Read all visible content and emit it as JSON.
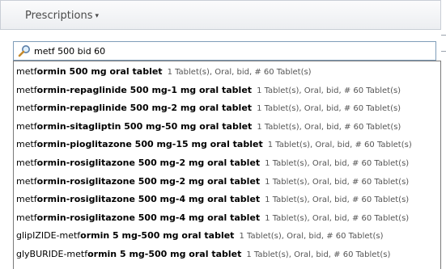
{
  "header": {
    "title": "Prescriptions",
    "dropdown_caret": "▾"
  },
  "search": {
    "value": "metf 500 bid 60",
    "icon": "search-magnifier-icon"
  },
  "results": [
    {
      "prefix": "metf",
      "name_rest": "ormin",
      "dose": " 500 mg oral tablet",
      "sig": "1 Tablet(s), Oral, bid, # 60 Tablet(s)"
    },
    {
      "prefix": "metf",
      "name_rest": "ormin-repaglinide",
      "dose": " 500 mg-1 mg oral tablet",
      "sig": "1 Tablet(s), Oral, bid, # 60 Tablet(s)"
    },
    {
      "prefix": "metf",
      "name_rest": "ormin-repaglinide",
      "dose": " 500 mg-2 mg oral tablet",
      "sig": "1 Tablet(s), Oral, bid, # 60 Tablet(s)"
    },
    {
      "prefix": "metf",
      "name_rest": "ormin-sitagliptin",
      "dose": " 500 mg-50 mg oral tablet",
      "sig": "1 Tablet(s), Oral, bid, # 60 Tablet(s)"
    },
    {
      "prefix": "metf",
      "name_rest": "ormin-pioglitazone",
      "dose": " 500 mg-15 mg oral tablet",
      "sig": "1 Tablet(s), Oral, bid, # 60 Tablet(s)"
    },
    {
      "prefix": "metf",
      "name_rest": "ormin-rosiglitazone",
      "dose": " 500 mg-2 mg oral tablet",
      "sig": "1 Tablet(s), Oral, bid, # 60 Tablet(s)"
    },
    {
      "prefix": "metf",
      "name_rest": "ormin-rosiglitazone",
      "dose": " 500 mg-2 mg oral tablet",
      "sig": "1 Tablet(s), Oral, bid, # 60 Tablet(s)"
    },
    {
      "prefix": "metf",
      "name_rest": "ormin-rosiglitazone",
      "dose": " 500 mg-4 mg oral tablet",
      "sig": "1 Tablet(s), Oral, bid, # 60 Tablet(s)"
    },
    {
      "prefix": "metf",
      "name_rest": "ormin-rosiglitazone",
      "dose": " 500 mg-4 mg oral tablet",
      "sig": "1 Tablet(s), Oral, bid, # 60 Tablet(s)"
    },
    {
      "prefix": "glipIZIDE-metf",
      "name_rest": "ormin",
      "dose": " 5 mg-500 mg oral tablet",
      "sig": "1 Tablet(s), Oral, bid, # 60 Tablet(s)"
    },
    {
      "prefix": "glyBURIDE-metf",
      "name_rest": "ormin",
      "dose": " 5 mg-500 mg oral tablet",
      "sig": "1 Tablet(s), Oral, bid, # 60 Tablet(s)"
    }
  ]
}
